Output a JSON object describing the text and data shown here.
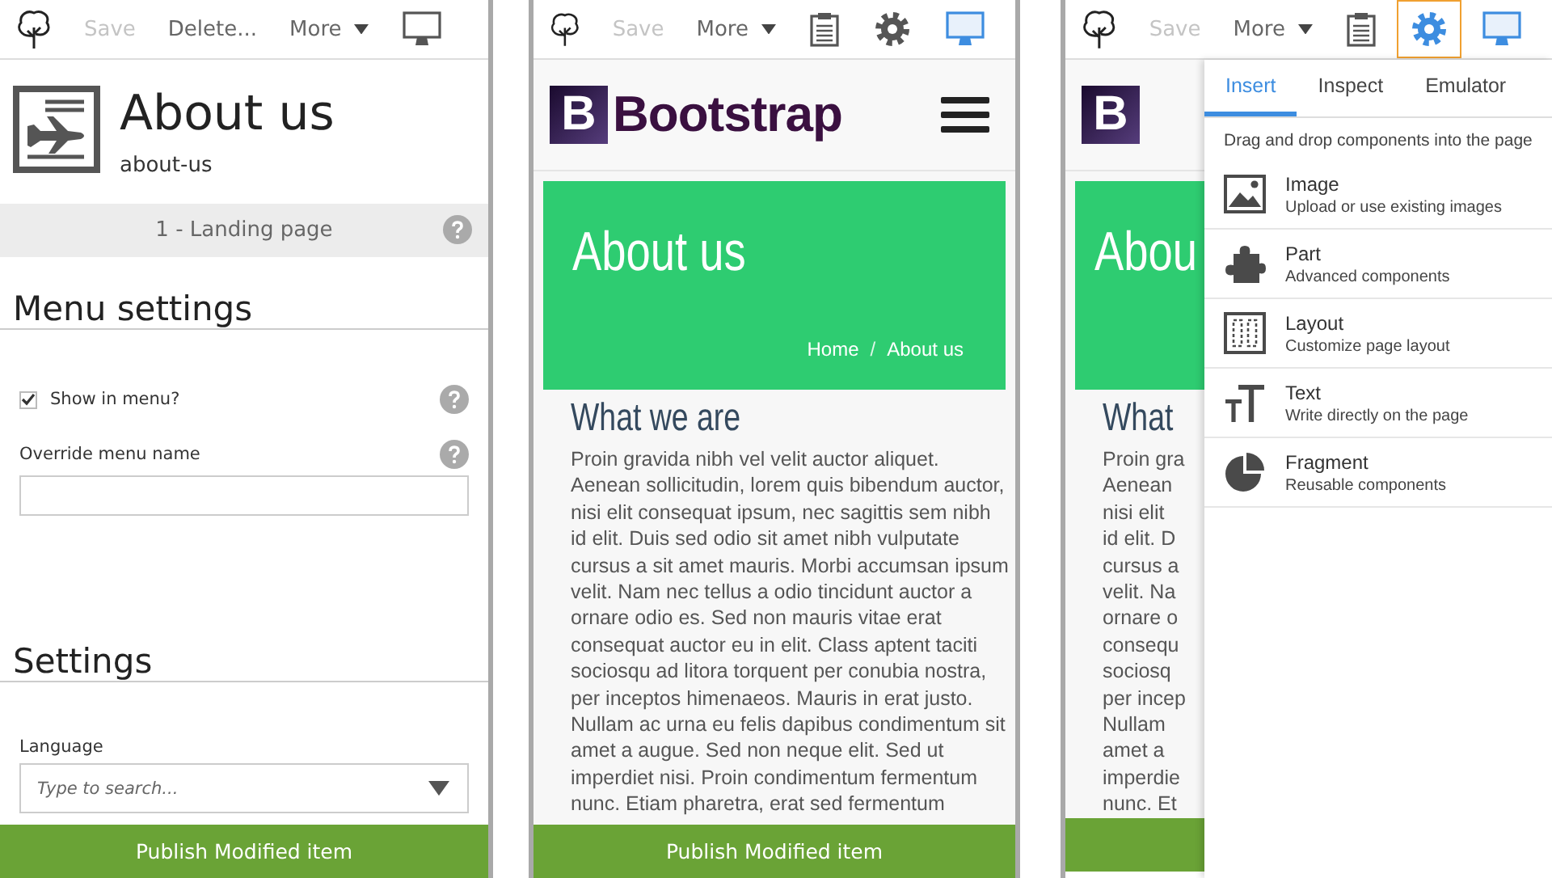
{
  "panels": [
    {
      "kind": "editor",
      "toolbar": [
        {
          "kind": "logo"
        },
        {
          "kind": "button",
          "label": "Save",
          "disabled": true
        },
        {
          "kind": "button",
          "label": "Delete...",
          "disabled": false
        },
        {
          "kind": "menu",
          "label": "More"
        },
        {
          "kind": "display",
          "selected": false,
          "focused": false
        }
      ],
      "page": {
        "title": "About us",
        "slug": "about-us"
      },
      "template": {
        "label": "1 - Landing page",
        "help": true
      },
      "sections": [
        {
          "title": "Menu settings",
          "fields": [
            {
              "kind": "checkbox",
              "label": "Show in menu?",
              "checked": true,
              "help": true
            },
            {
              "kind": "text",
              "label": "Override menu name",
              "help": true
            }
          ]
        },
        {
          "title": "Settings",
          "fields": [
            {
              "kind": "select",
              "label": "Language",
              "placeholder": "Type to search...",
              "help": false
            }
          ]
        }
      ],
      "publish_bar": {
        "label": "Publish Modified item"
      }
    },
    {
      "kind": "preview",
      "toolbar": [
        {
          "kind": "logo"
        },
        {
          "kind": "button",
          "label": "Save",
          "disabled": true
        },
        {
          "kind": "menu",
          "label": "More"
        },
        {
          "kind": "notes",
          "selected": false,
          "focused": false
        },
        {
          "kind": "settings",
          "selected": false,
          "focused": false
        },
        {
          "kind": "display",
          "selected": true,
          "focused": false
        }
      ],
      "brand": {
        "mark": "B",
        "name": "Bootstrap",
        "menu": true
      },
      "hero": {
        "title": "About us",
        "separator": "/",
        "breadcrumb": [
          "Home",
          "About us"
        ]
      },
      "heading": "What we are",
      "paragraph_lines": [
        "Proin gravida nibh vel velit auctor aliquet.",
        "Aenean sollicitudin, lorem quis bibendum auctor,",
        "nisi elit consequat ipsum, nec sagittis sem nibh",
        "id elit. Duis sed odio sit amet nibh vulputate",
        "cursus a sit amet mauris. Morbi accumsan ipsum",
        "velit. Nam nec tellus a odio tincidunt auctor a",
        "ornare odio es. Sed non mauris vitae erat",
        "consequat auctor eu in elit. Class aptent taciti",
        "sociosqu ad litora torquent per conubia nostra,",
        "per inceptos himenaeos. Mauris in erat justo.",
        "Nullam ac urna eu felis dapibus condimentum sit",
        "amet a augue. Sed non neque elit. Sed ut",
        "imperdiet nisi. Proin condimentum fermentum",
        "nunc. Etiam pharetra, erat sed fermentum"
      ],
      "publish_bar": {
        "label": "Publish Modified item"
      }
    },
    {
      "kind": "preview",
      "toolbar": [
        {
          "kind": "logo"
        },
        {
          "kind": "button",
          "label": "Save",
          "disabled": true
        },
        {
          "kind": "menu",
          "label": "More"
        },
        {
          "kind": "notes",
          "selected": false,
          "focused": false
        },
        {
          "kind": "settings",
          "selected": true,
          "focused": true
        },
        {
          "kind": "display",
          "selected": true,
          "focused": false
        }
      ],
      "brand": {
        "mark": "B"
      },
      "hero": {
        "title": "Abou"
      },
      "heading": "What",
      "paragraph_lines": [
        "Proin gra",
        "Aenean",
        "nisi elit",
        "id elit. D",
        "cursus a",
        "velit. Na",
        "ornare o",
        "consequ",
        "sociosq",
        "per incep",
        "Nullam",
        "amet a",
        "imperdie",
        "nunc. Et"
      ],
      "insert_panel": {
        "tabs": [
          {
            "label": "Insert",
            "selected": true
          },
          {
            "label": "Inspect",
            "selected": false
          },
          {
            "label": "Emulator",
            "selected": false
          }
        ],
        "hint": "Drag and drop components into the page",
        "items": [
          {
            "kind": "image",
            "title": "Image",
            "description": "Upload or use existing images"
          },
          {
            "kind": "part",
            "title": "Part",
            "description": "Advanced components"
          },
          {
            "kind": "layout",
            "title": "Layout",
            "description": "Customize page layout"
          },
          {
            "kind": "text",
            "title": "Text",
            "description": "Write directly on the page"
          },
          {
            "kind": "fragment",
            "title": "Fragment",
            "description": "Reusable components"
          }
        ]
      }
    }
  ]
}
